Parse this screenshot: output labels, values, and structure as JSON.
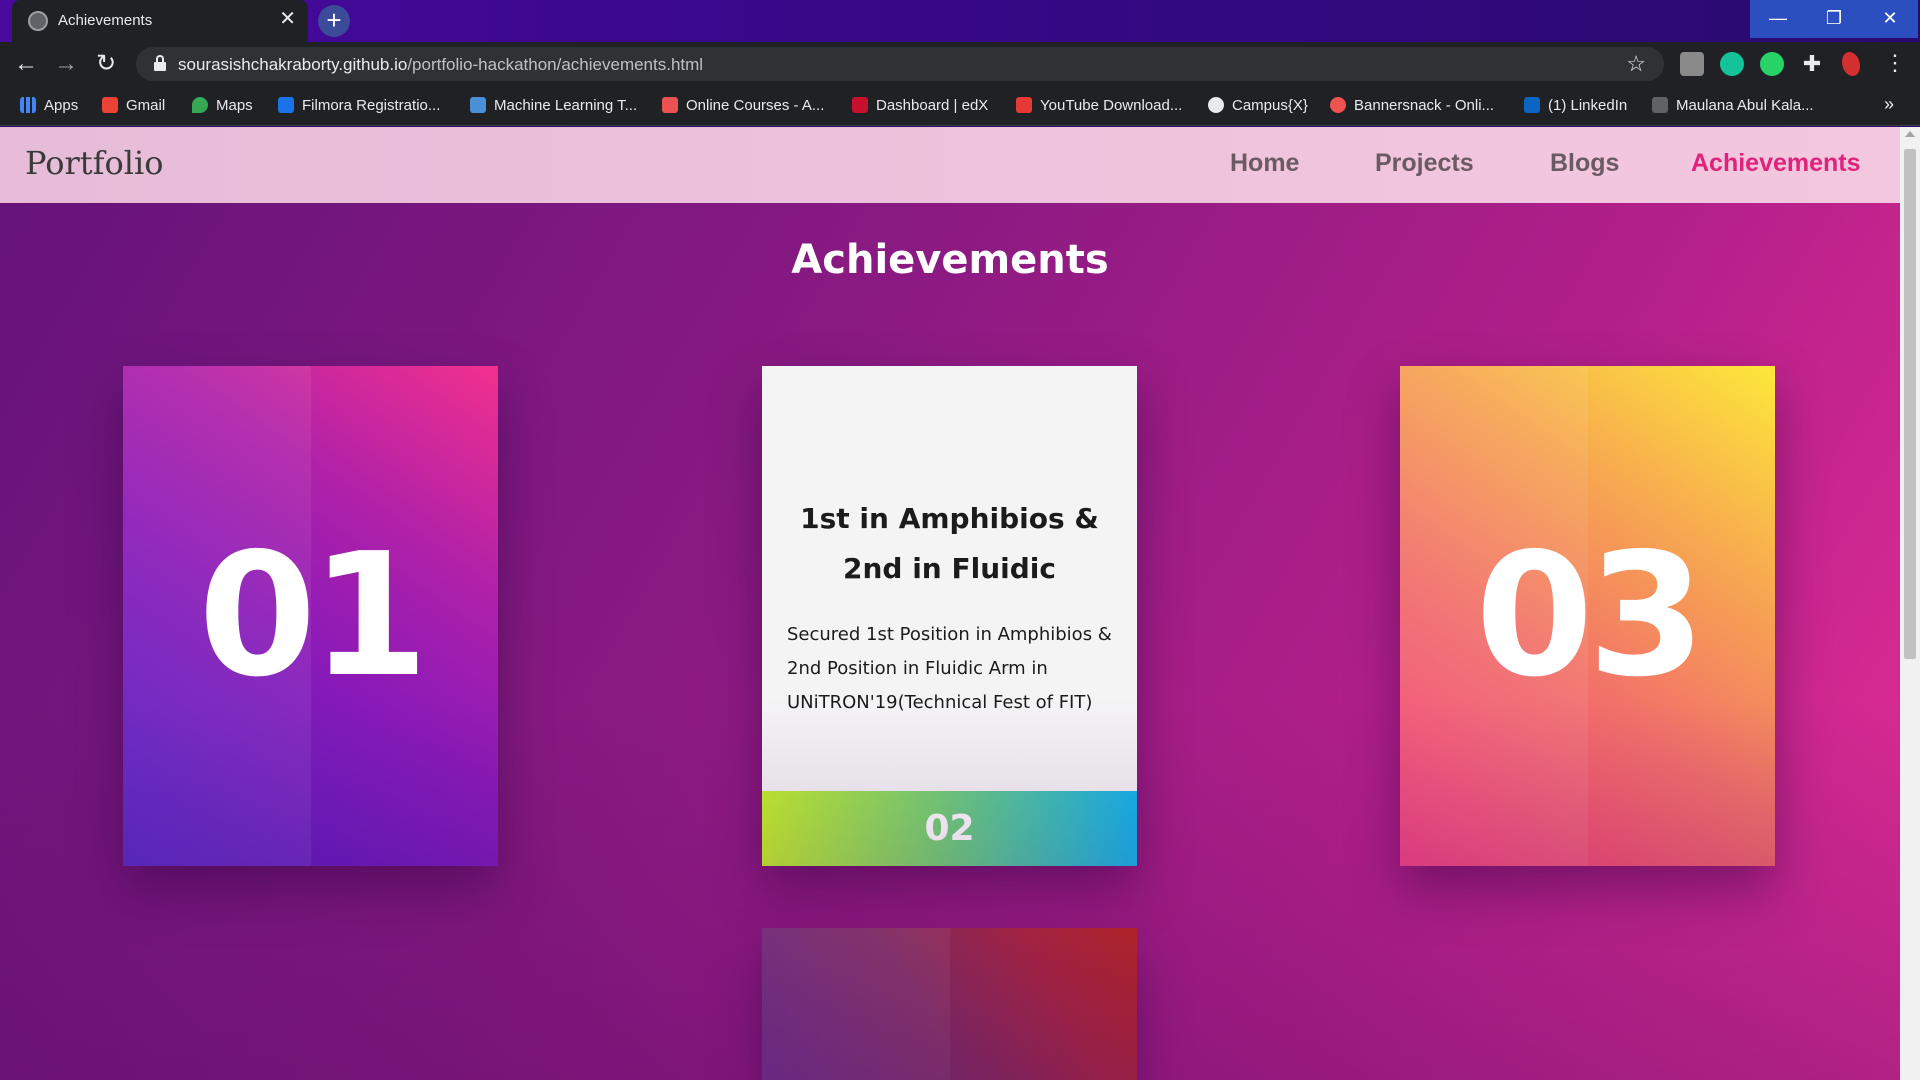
{
  "browser": {
    "tab_title": "Achievements",
    "tab_close": "✕",
    "new_tab": "+",
    "url_host": "sourasishchakraborty.github.io",
    "url_path": "/portfolio-hackathon/achievements.html",
    "bookmarks": [
      {
        "label": "Apps",
        "icon": "apps-grid-icon",
        "color": "#4285f4"
      },
      {
        "label": "Gmail",
        "icon": "gmail-icon",
        "color": "#ea4335"
      },
      {
        "label": "Maps",
        "icon": "maps-icon",
        "color": "#34a853"
      },
      {
        "label": "Filmora Registratio...",
        "icon": "filmora-icon",
        "color": "#1a73e8"
      },
      {
        "label": "Machine Learning T...",
        "icon": "is-icon",
        "color": "#4a90d9"
      },
      {
        "label": "Online Courses - A...",
        "icon": "udemy-icon",
        "color": "#ec5252"
      },
      {
        "label": "Dashboard | edX",
        "icon": "edx-icon",
        "color": "#c8102e"
      },
      {
        "label": "YouTube Download...",
        "icon": "download-icon",
        "color": "#e53935"
      },
      {
        "label": "Campus{X}",
        "icon": "globe-icon",
        "color": "#e8eaed"
      },
      {
        "label": "Bannersnack - Onli...",
        "icon": "bannersnack-icon",
        "color": "#ef5350"
      },
      {
        "label": "(1) LinkedIn",
        "icon": "linkedin-icon",
        "color": "#0a66c2"
      },
      {
        "label": "Maulana Abul Kala...",
        "icon": "cap-icon",
        "color": "#5f6368"
      }
    ],
    "bookmarks_more": "»"
  },
  "site": {
    "brand": "Portfolio",
    "nav": [
      {
        "label": "Home",
        "active": false
      },
      {
        "label": "Projects",
        "active": false
      },
      {
        "label": "Blogs",
        "active": false
      },
      {
        "label": "Achievements",
        "active": true
      }
    ],
    "accent_color": "#e0227a"
  },
  "page": {
    "title": "Achievements",
    "cards": [
      {
        "number": "01"
      },
      {
        "number": "02",
        "heading": "1st in Amphibios & 2nd in Fluidic",
        "description": "Secured 1st Position in Amphibios & 2nd Position in Fluidic Arm in UNiTRON'19(Technical Fest of FIT)"
      },
      {
        "number": "03"
      }
    ]
  }
}
